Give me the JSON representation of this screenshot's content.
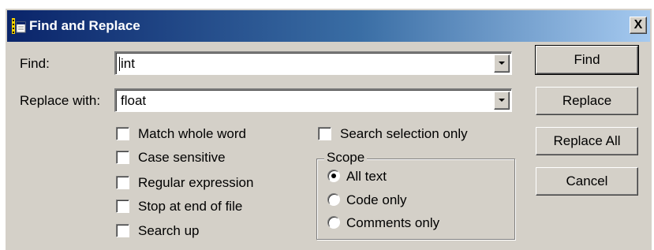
{
  "window": {
    "title": "Find and Replace",
    "close_glyph": "X",
    "titlebar_colors": [
      "#0a246a",
      "#a6caf0"
    ],
    "face_color": "#d4d0c8"
  },
  "find": {
    "label": "Find:",
    "value": "int"
  },
  "replace": {
    "label": "Replace with:",
    "value": "float"
  },
  "options": [
    {
      "label": "Match whole word",
      "checked": false
    },
    {
      "label": "Case sensitive",
      "checked": false
    },
    {
      "label": "Regular expression",
      "checked": false
    },
    {
      "label": "Stop at end of file",
      "checked": false
    },
    {
      "label": "Search up",
      "checked": false
    }
  ],
  "search_selection_only": {
    "label": "Search selection only",
    "checked": false
  },
  "scope": {
    "label": "Scope",
    "options": [
      {
        "label": "All text",
        "selected": true
      },
      {
        "label": "Code only",
        "selected": false
      },
      {
        "label": "Comments only",
        "selected": false
      }
    ]
  },
  "buttons": {
    "find": "Find",
    "replace": "Replace",
    "replace_all": "Replace All",
    "cancel": "Cancel"
  }
}
